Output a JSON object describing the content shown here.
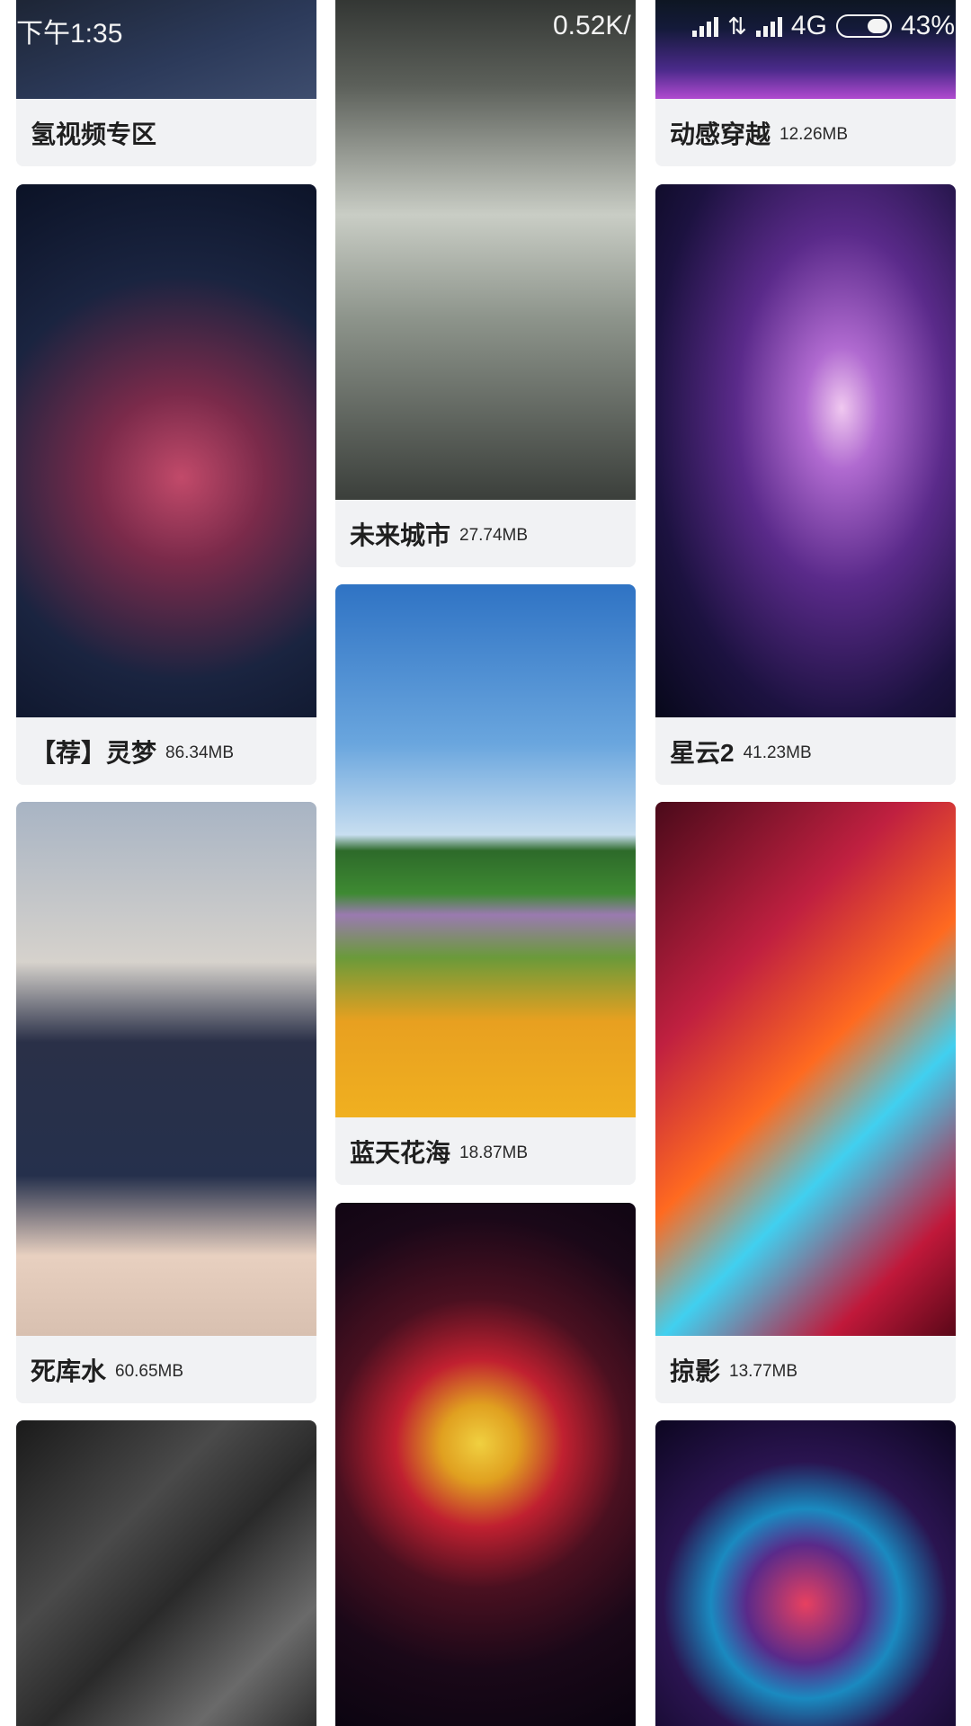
{
  "status_bar": {
    "time": "下午1:35",
    "net_speed": "0.52K/",
    "network": "4G",
    "battery": "43%",
    "icons": [
      "signal-icon",
      "data-arrows-icon",
      "signal-icon",
      "battery-icon"
    ]
  },
  "columns": [
    {
      "cards": [
        {
          "name": "氢视频专区",
          "size": "",
          "art": "dark-blue"
        },
        {
          "name": "【荐】灵梦",
          "size": "86.34MB",
          "art": "anime-girl-space"
        },
        {
          "name": "死库水",
          "size": "60.65MB",
          "art": "cosplay-photo"
        },
        {
          "name": "",
          "size": "",
          "art": "gray-polygons"
        }
      ]
    },
    {
      "cards": [
        {
          "name": "未来城市",
          "size": "27.74MB",
          "art": "future-city"
        },
        {
          "name": "蓝天花海",
          "size": "18.87MB",
          "art": "flower-field"
        },
        {
          "name": "",
          "size": "",
          "art": "neon-tunnel-rings"
        }
      ]
    },
    {
      "cards": [
        {
          "name": "动感穿越",
          "size": "12.26MB",
          "art": "neon-purple"
        },
        {
          "name": "星云2",
          "size": "41.23MB",
          "art": "nebula"
        },
        {
          "name": "掠影",
          "size": "13.77MB",
          "art": "light-warp"
        },
        {
          "name": "",
          "size": "",
          "art": "neon-tunnel-colorful"
        }
      ]
    }
  ]
}
